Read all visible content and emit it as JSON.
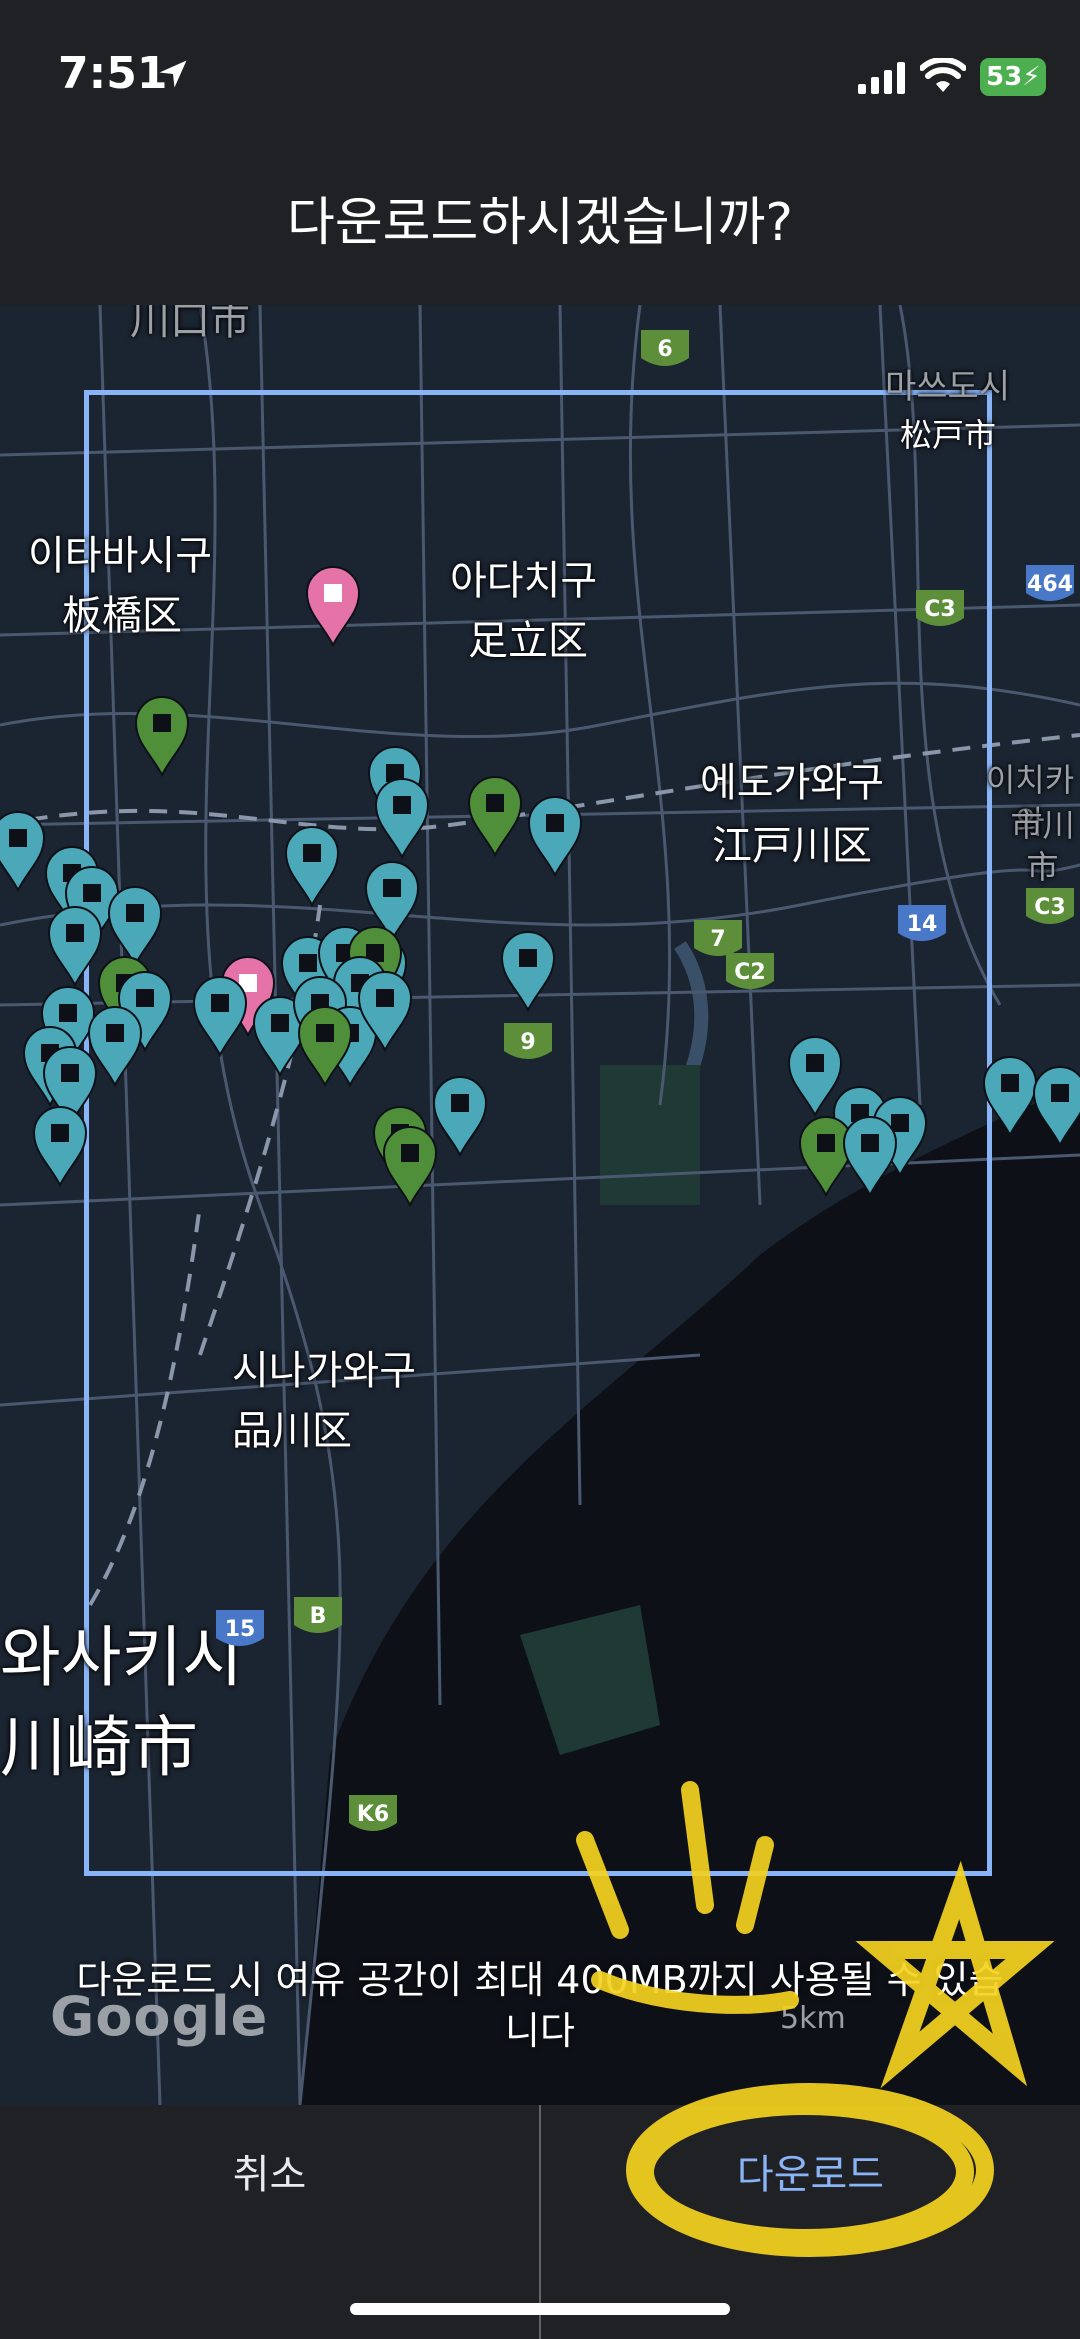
{
  "status": {
    "time": "7:51",
    "battery": "53"
  },
  "dialog": {
    "title": "다운로드하시겠습니까?",
    "note": "다운로드 시 여유 공간이 최대 400MB까지 사용될 수 있습니다",
    "cancel_label": "취소",
    "download_label": "다운로드"
  },
  "map": {
    "labels": {
      "kawaguchi": "川口市",
      "itabashi_ko": "이타바시구",
      "itabashi_ja": "板橋区",
      "adachi_ko": "아다치구",
      "adachi_ja": "足立区",
      "matsudo_ko": "마쓰도시",
      "matsudo_ja": "松戸市",
      "edogawa_ko": "에도가와구",
      "edogawa_ja": "江戸川区",
      "ichikawa_ko": "이치카와",
      "ichikawa_ja": "市川市",
      "shinagawa_ko": "시나가와구",
      "shinagawa_ja": "品川区",
      "kawasaki_ko": "와사키시",
      "kawasaki_ja": "川崎市"
    },
    "route_badges": [
      "6",
      "C3",
      "464",
      "7",
      "C2",
      "14",
      "9",
      "C3",
      "B",
      "15",
      "K6"
    ],
    "google": "Google",
    "scale": "5km",
    "colors": {
      "selection": "#8ab4f8",
      "pin_teal": "#4aa8b8",
      "pin_green": "#4f8f3a",
      "pin_pink": "#e573a8"
    }
  }
}
